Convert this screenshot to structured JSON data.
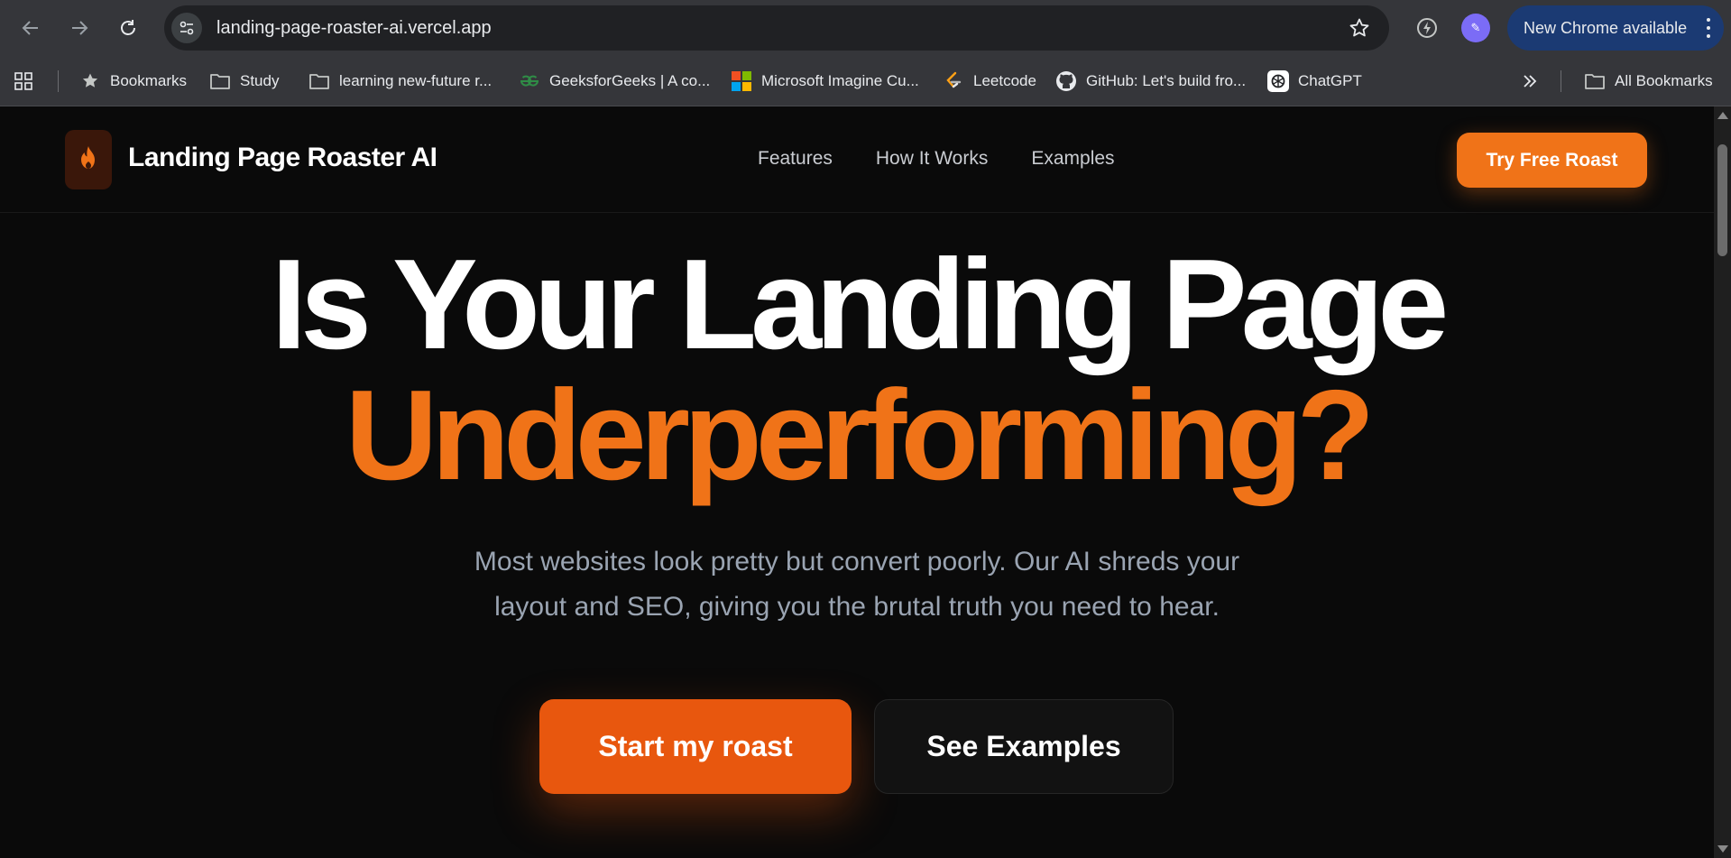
{
  "browser": {
    "url": "landing-page-roaster-ai.vercel.app",
    "update_label": "New Chrome available",
    "extension_glyph": "✎"
  },
  "bookmarks": {
    "items": [
      {
        "label": "Bookmarks",
        "icon": "star-icon"
      },
      {
        "label": "Study",
        "icon": "folder-icon"
      },
      {
        "label": "learning new-future r...",
        "icon": "folder-icon"
      },
      {
        "label": "GeeksforGeeks | A co...",
        "icon": "geeksforgeeks-icon"
      },
      {
        "label": "Microsoft Imagine Cu...",
        "icon": "microsoft-icon"
      },
      {
        "label": "Leetcode",
        "icon": "leetcode-icon"
      },
      {
        "label": "GitHub: Let's build fro...",
        "icon": "github-icon"
      },
      {
        "label": "ChatGPT",
        "icon": "chatgpt-icon"
      }
    ],
    "all_label": "All Bookmarks"
  },
  "site": {
    "brand": "Landing Page Roaster AI",
    "nav": [
      "Features",
      "How It Works",
      "Examples"
    ],
    "cta_top": "Try Free Roast",
    "accent_color": "#f07318"
  },
  "hero": {
    "line1": "Is Your Landing Page",
    "line2": "Underperforming?",
    "subtitle_line1": "Most websites look pretty but convert poorly. Our AI shreds your",
    "subtitle_line2": "layout and SEO, giving you the brutal truth you need to hear.",
    "primary_button": "Start my roast",
    "secondary_button": "See Examples"
  }
}
